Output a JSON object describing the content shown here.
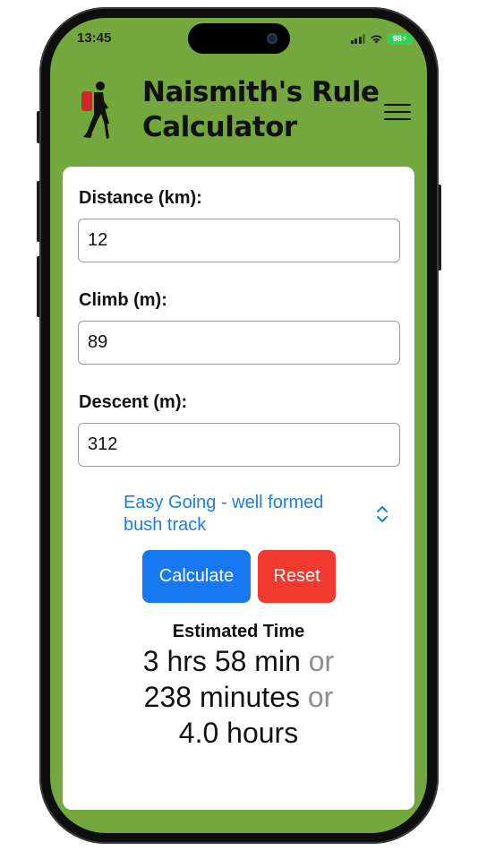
{
  "status_bar": {
    "time": "13:45",
    "battery": "98"
  },
  "header": {
    "title_line1": "Naismith's Rule",
    "title_line2": "Calculator",
    "logo_icon": "hiker-icon",
    "menu_icon": "hamburger-menu-icon"
  },
  "form": {
    "distance_label": "Distance (km):",
    "distance_value": "12",
    "climb_label": "Climb (m):",
    "climb_value": "89",
    "descent_label": "Descent (m):",
    "descent_value": "312",
    "terrain_selected": "Easy Going - well formed bush track"
  },
  "buttons": {
    "calculate": "Calculate",
    "reset": "Reset"
  },
  "result": {
    "heading": "Estimated Time",
    "hours_minutes": "3 hrs 58 min",
    "minutes": "238 minutes",
    "hours": "4.0 hours",
    "or_word": "or"
  },
  "colors": {
    "header_green": "#74a83f",
    "link_blue": "#1a7fe0",
    "calculate_blue": "#1878f2",
    "reset_red": "#f0392f"
  }
}
